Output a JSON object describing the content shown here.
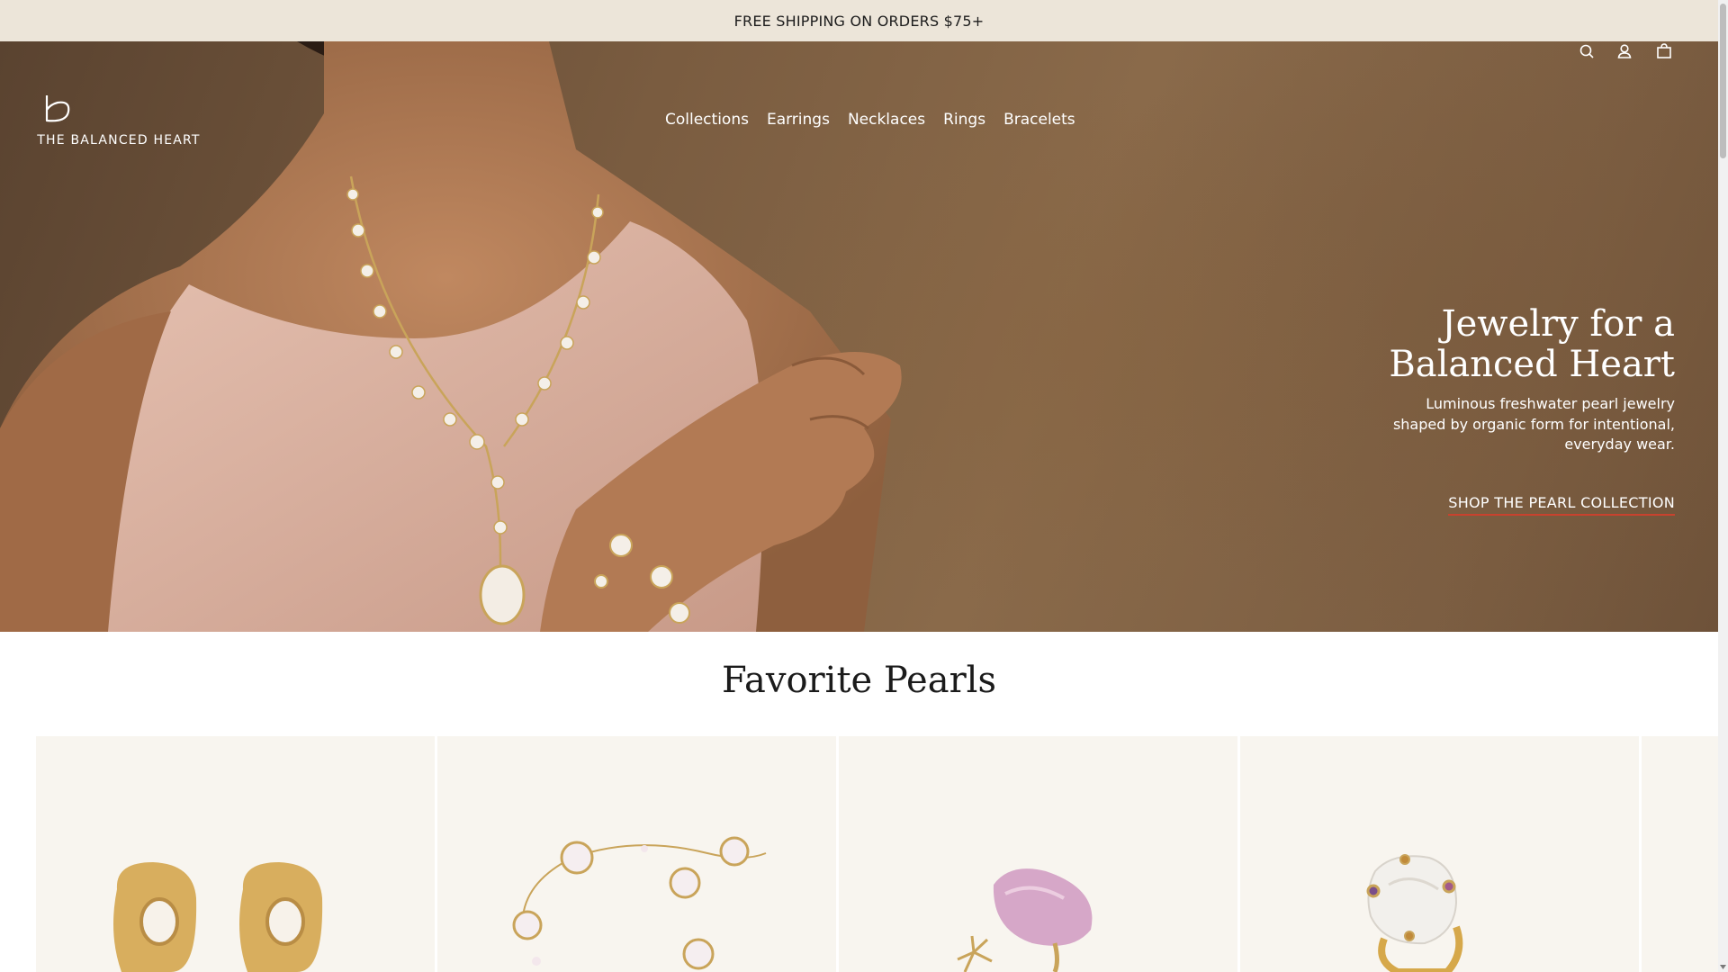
{
  "announcement": {
    "text": "FREE SHIPPING ON ORDERS $75+"
  },
  "header": {
    "logo_text": "THE BALANCED HEART",
    "nav": [
      "Collections",
      "Earrings",
      "Necklaces",
      "Rings",
      "Bracelets"
    ],
    "icons": [
      "search-icon",
      "account-icon",
      "cart-icon"
    ]
  },
  "hero": {
    "title_line1": "Jewelry for a",
    "title_line2": "Balanced Heart",
    "subtitle_line1": "Luminous freshwater pearl jewelry",
    "subtitle_line2": "shaped by organic form for intentional,",
    "subtitle_line3": "everyday wear.",
    "cta": "SHOP THE PEARL COLLECTION"
  },
  "section": {
    "title": "Favorite Pearls"
  },
  "products": [
    {
      "image": "pearl-stud-earrings"
    },
    {
      "image": "pearl-chain-bracelet"
    },
    {
      "image": "pink-pearl-flower-ring"
    },
    {
      "image": "baroque-pearl-gold-ring"
    }
  ],
  "colors": {
    "announcement_bg": "#ece5d9",
    "card_bg": "#f8f5ef",
    "cta_underline": "#c8422e",
    "text_dark": "#1b1b1b"
  }
}
